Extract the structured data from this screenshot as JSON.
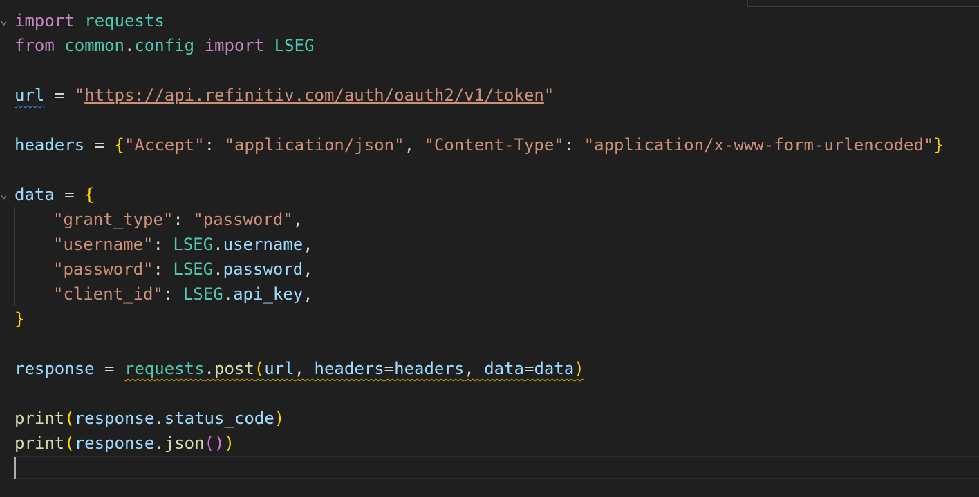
{
  "editor": {
    "language": "python",
    "fold_marker": "⌄",
    "colors": {
      "background": "#1f1f1f",
      "keyword": "#c586c0",
      "module": "#4ec9b0",
      "variable": "#9cdcfe",
      "string": "#ce9178",
      "function": "#dcdcaa",
      "bracket_level1": "#ffd700",
      "bracket_level2": "#da70d6",
      "warning_squiggle": "#cca700",
      "info_squiggle": "#3794ff"
    },
    "lines": {
      "l1": {
        "kw": "import",
        "mod": "requests"
      },
      "l2": {
        "kw1": "from",
        "mod1": "common",
        "dot": ".",
        "mod2": "config",
        "kw2": "import",
        "mod3": "LSEG"
      },
      "l4": {
        "var": "url",
        "op": " = ",
        "q1": "\"",
        "url": "https://api.refinitiv.com/auth/oauth2/v1/token",
        "q2": "\""
      },
      "l6": {
        "var": "headers",
        "op": " = ",
        "open": "{",
        "k1": "\"Accept\"",
        "c1": ": ",
        "v1": "\"application/json\"",
        "sep": ", ",
        "k2": "\"Content-Type\"",
        "c2": ": ",
        "v2": "\"application/x-www-form-urlencoded\"",
        "close": "}"
      },
      "l8": {
        "var": "data",
        "op": " = ",
        "open": "{"
      },
      "l9": {
        "key": "\"grant_type\"",
        "colon": ": ",
        "val": "\"password\"",
        "comma": ","
      },
      "l10": {
        "key": "\"username\"",
        "colon": ": ",
        "obj": "LSEG",
        "dot": ".",
        "attr": "username",
        "comma": ","
      },
      "l11": {
        "key": "\"password\"",
        "colon": ": ",
        "obj": "LSEG",
        "dot": ".",
        "attr": "password",
        "comma": ","
      },
      "l12": {
        "key": "\"client_id\"",
        "colon": ": ",
        "obj": "LSEG",
        "dot": ".",
        "attr": "api_key",
        "comma": ","
      },
      "l13": {
        "close": "}"
      },
      "l15": {
        "var": "response",
        "op": " = ",
        "mod": "requests",
        "dot": ".",
        "fn": "post",
        "open": "(",
        "a1": "url",
        "sep1": ", ",
        "k1": "headers",
        "eq1": "=",
        "v1": "headers",
        "sep2": ", ",
        "k2": "data",
        "eq2": "=",
        "v2": "data",
        "close": ")"
      },
      "l17": {
        "fn": "print",
        "open": "(",
        "obj": "response",
        "dot": ".",
        "attr": "status_code",
        "close": ")"
      },
      "l18": {
        "fn": "print",
        "open": "(",
        "obj": "response",
        "dot": ".",
        "fn2": "json",
        "inner": "()",
        "close": ")"
      }
    }
  }
}
